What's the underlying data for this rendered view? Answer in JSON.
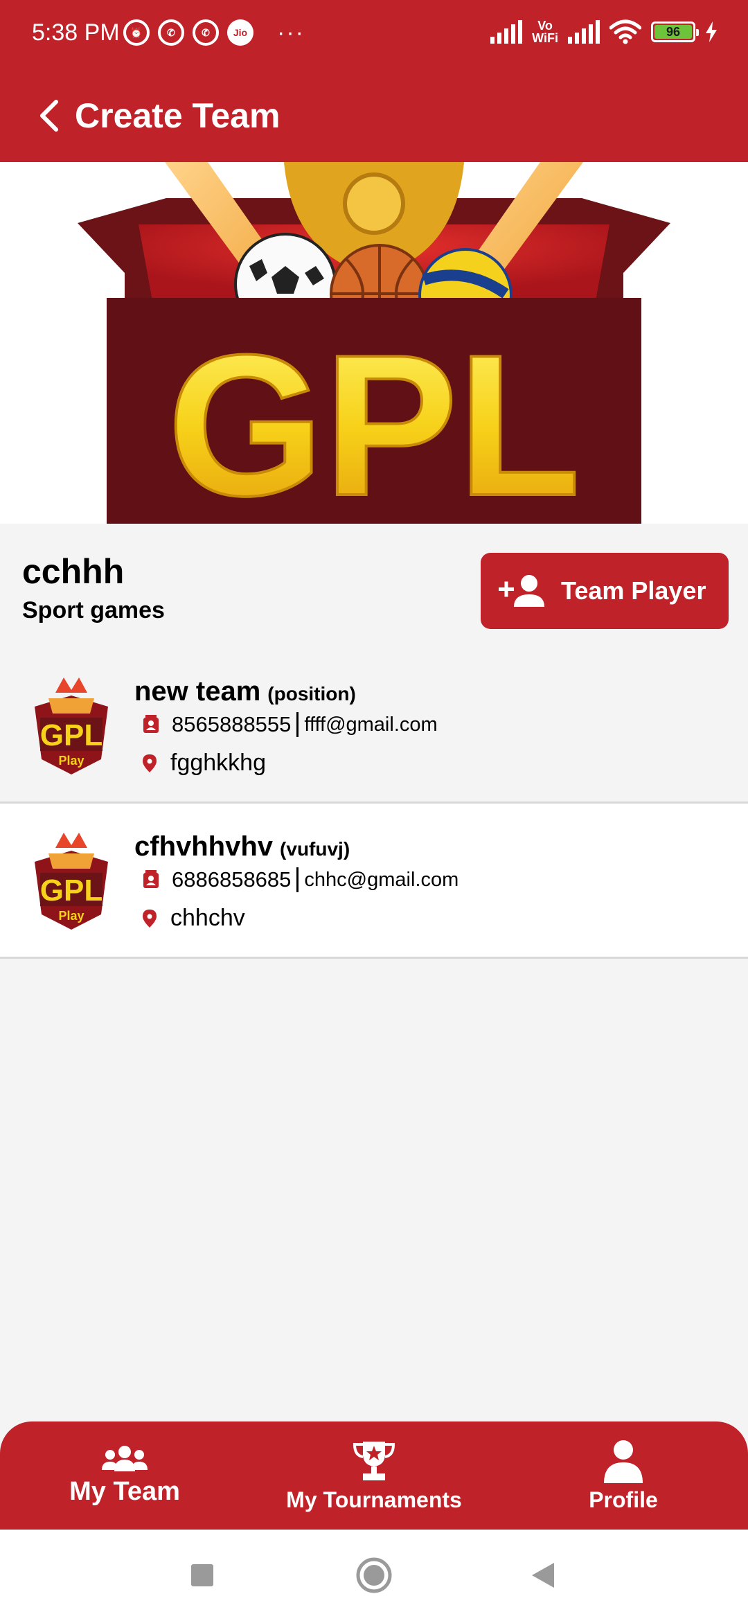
{
  "status_bar": {
    "time": "5:38 PM",
    "vowifi_line1": "Vo",
    "vowifi_line2": "WiFi",
    "battery": "96",
    "jio": "Jio",
    "more": "···"
  },
  "app_bar": {
    "title": "Create Team"
  },
  "banner": {
    "logo_text": "GPL"
  },
  "team": {
    "name": "cchhh",
    "subtitle": "Sport games",
    "add_button_label": "Team Player"
  },
  "players": [
    {
      "name": "new team",
      "position": "(position)",
      "phone": "8565888555",
      "email": "ffff@gmail.com",
      "location": "fgghkkhg",
      "logo_text": "GPL",
      "logo_sub": "Play"
    },
    {
      "name": "cfhvhhvhv",
      "position": "(vufuvj)",
      "phone": "6886858685",
      "email": "chhc@gmail.com",
      "location": "chhchv",
      "logo_text": "GPL",
      "logo_sub": "Play"
    }
  ],
  "bottom_nav": [
    {
      "label": "My Team",
      "icon": "group-icon"
    },
    {
      "label": "My Tournaments",
      "icon": "trophy-icon"
    },
    {
      "label": "Profile",
      "icon": "person-icon"
    }
  ],
  "colors": {
    "primary": "#c0222a",
    "background": "#f4f4f4",
    "logo_gold": "#f5c400"
  }
}
